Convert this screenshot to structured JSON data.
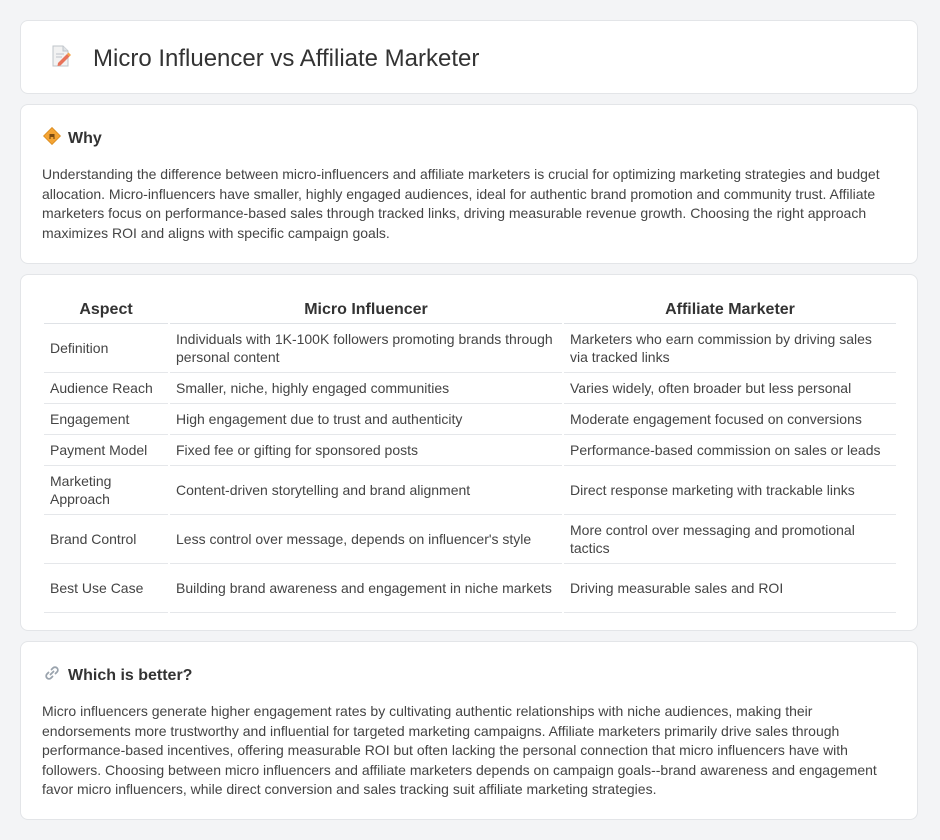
{
  "header": {
    "title": "Micro Influencer vs Affiliate Marketer",
    "icon": "document-pencil-icon"
  },
  "why": {
    "icon": "diamond-sign-icon",
    "title": "Why",
    "text": "Understanding the difference between micro-influencers and affiliate marketers is crucial for optimizing marketing strategies and budget allocation. Micro-influencers have smaller, highly engaged audiences, ideal for authentic brand promotion and community trust. Affiliate marketers focus on performance-based sales through tracked links, driving measurable revenue growth. Choosing the right approach maximizes ROI and aligns with specific campaign goals."
  },
  "comparison": {
    "headers": [
      "Aspect",
      "Micro Influencer",
      "Affiliate Marketer"
    ],
    "rows": [
      [
        "Definition",
        "Individuals with 1K-100K followers promoting brands through personal content",
        "Marketers who earn commission by driving sales via tracked links"
      ],
      [
        "Audience Reach",
        "Smaller, niche, highly engaged communities",
        "Varies widely, often broader but less personal"
      ],
      [
        "Engagement",
        "High engagement due to trust and authenticity",
        "Moderate engagement focused on conversions"
      ],
      [
        "Payment Model",
        "Fixed fee or gifting for sponsored posts",
        "Performance-based commission on sales or leads"
      ],
      [
        "Marketing Approach",
        "Content-driven storytelling and brand alignment",
        "Direct response marketing with trackable links"
      ],
      [
        "Brand Control",
        "Less control over message, depends on influencer's style",
        "More control over messaging and promotional tactics"
      ],
      [
        "Best Use Case",
        "Building brand awareness and engagement in niche markets",
        "Driving measurable sales and ROI"
      ]
    ]
  },
  "better": {
    "icon": "link-icon",
    "title": "Which is better?",
    "text": "Micro influencers generate higher engagement rates by cultivating authentic relationships with niche audiences, making their endorsements more trustworthy and influential for targeted marketing campaigns. Affiliate marketers primarily drive sales through performance-based incentives, offering measurable ROI but often lacking the personal connection that micro influencers have with followers. Choosing between micro influencers and affiliate marketers depends on campaign goals--brand awareness and engagement favor micro influencers, while direct conversion and sales tracking suit affiliate marketing strategies."
  }
}
